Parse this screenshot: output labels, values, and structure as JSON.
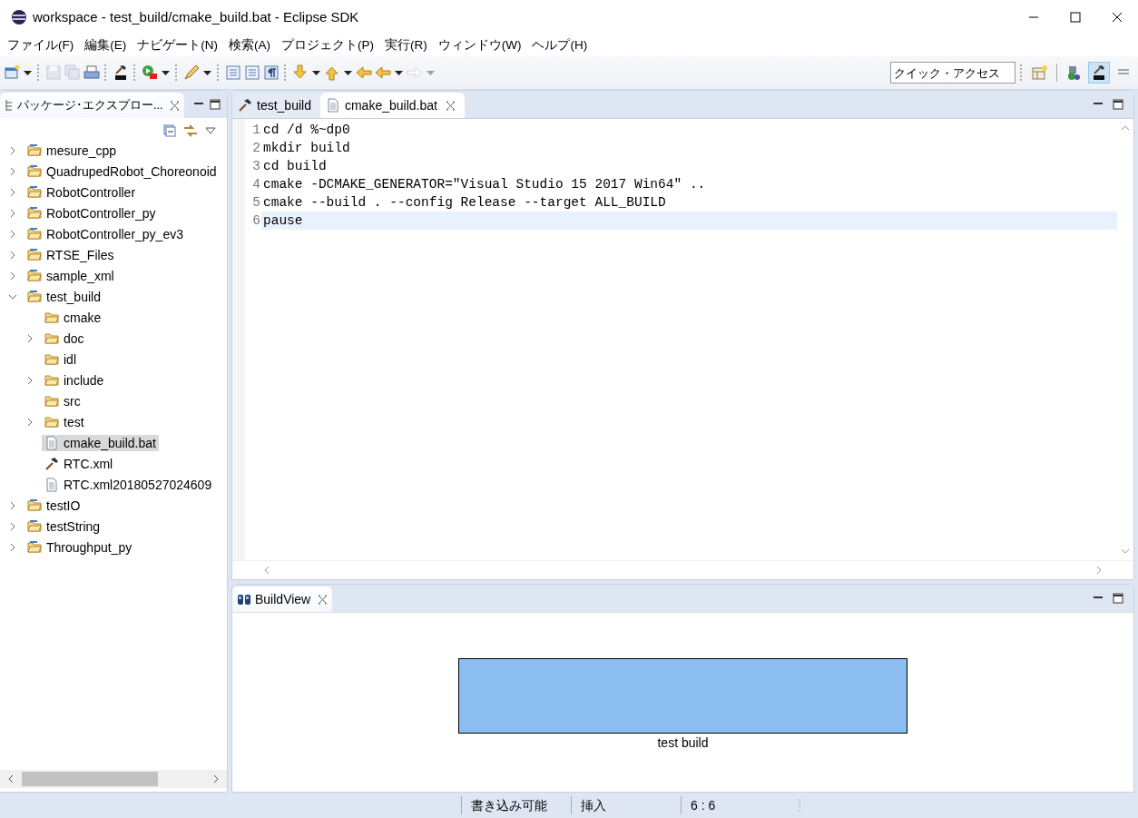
{
  "window": {
    "title": "workspace - test_build/cmake_build.bat - Eclipse SDK"
  },
  "menu": [
    "ファイル(F)",
    "編集(E)",
    "ナビゲート(N)",
    "検索(A)",
    "プロジェクト(P)",
    "実行(R)",
    "ウィンドウ(W)",
    "ヘルプ(H)"
  ],
  "toolbar": [
    {
      "kind": "new",
      "disabled": false
    },
    {
      "kind": "dropdown",
      "disabled": false
    },
    {
      "kind": "sep"
    },
    {
      "kind": "save",
      "disabled": true
    },
    {
      "kind": "save-all",
      "disabled": true
    },
    {
      "kind": "print",
      "disabled": false
    },
    {
      "kind": "sep"
    },
    {
      "kind": "rt",
      "disabled": false
    },
    {
      "kind": "sep"
    },
    {
      "kind": "run",
      "disabled": false
    },
    {
      "kind": "dropdown",
      "disabled": false
    },
    {
      "kind": "sep"
    },
    {
      "kind": "pen",
      "disabled": false
    },
    {
      "kind": "dropdown",
      "disabled": false
    },
    {
      "kind": "sep"
    },
    {
      "kind": "doc",
      "disabled": false
    },
    {
      "kind": "doc",
      "disabled": false
    },
    {
      "kind": "para",
      "disabled": false
    },
    {
      "kind": "sep"
    },
    {
      "kind": "down",
      "disabled": false
    },
    {
      "kind": "dropdown",
      "disabled": false
    },
    {
      "kind": "up",
      "disabled": false
    },
    {
      "kind": "dropdown",
      "disabled": false
    },
    {
      "kind": "back",
      "disabled": false
    },
    {
      "kind": "back",
      "disabled": false
    },
    {
      "kind": "dropdown",
      "disabled": false
    },
    {
      "kind": "forward",
      "disabled": true
    },
    {
      "kind": "dropdown",
      "disabled": true
    }
  ],
  "quick_access": {
    "placeholder": "クイック・アクセス"
  },
  "perspectives": [
    {
      "kind": "open",
      "selected": false
    },
    {
      "kind": "java",
      "selected": false
    },
    {
      "kind": "rt",
      "selected": true
    },
    {
      "kind": "rt-plain",
      "selected": false
    }
  ],
  "explorer": {
    "title": "パッケージ･エクスプロー...",
    "items": [
      {
        "label": "mesure_cpp",
        "kind": "project",
        "expanded": false,
        "selected": false
      },
      {
        "label": "QuadrupedRobot_Choreonoid",
        "kind": "project",
        "expanded": false,
        "selected": false
      },
      {
        "label": "RobotController",
        "kind": "project",
        "expanded": false,
        "selected": false
      },
      {
        "label": "RobotController_py",
        "kind": "project",
        "expanded": false,
        "selected": false
      },
      {
        "label": "RobotController_py_ev3",
        "kind": "project",
        "expanded": false,
        "selected": false
      },
      {
        "label": "RTSE_Files",
        "kind": "project",
        "expanded": false,
        "selected": false
      },
      {
        "label": "sample_xml",
        "kind": "project",
        "expanded": false,
        "selected": false
      },
      {
        "label": "test_build",
        "kind": "project",
        "expanded": true,
        "selected": false,
        "children": [
          {
            "label": "cmake",
            "kind": "folder",
            "selected": false
          },
          {
            "label": "doc",
            "kind": "folder",
            "expanded": false,
            "selected": false
          },
          {
            "label": "idl",
            "kind": "folder",
            "selected": false
          },
          {
            "label": "include",
            "kind": "folder",
            "expanded": false,
            "selected": false
          },
          {
            "label": "src",
            "kind": "folder",
            "selected": false
          },
          {
            "label": "test",
            "kind": "folder",
            "expanded": false,
            "selected": false
          },
          {
            "label": "cmake_build.bat",
            "kind": "file",
            "selected": true
          },
          {
            "label": "RTC.xml",
            "kind": "rtc",
            "selected": false
          },
          {
            "label": "RTC.xml20180527024609",
            "kind": "file",
            "selected": false
          }
        ]
      },
      {
        "label": "testIO",
        "kind": "project",
        "expanded": false,
        "selected": false
      },
      {
        "label": "testString",
        "kind": "project",
        "expanded": false,
        "selected": false
      },
      {
        "label": "Throughput_py",
        "kind": "project",
        "expanded": false,
        "selected": false
      }
    ]
  },
  "editor": {
    "tabs": [
      {
        "label": "test_build",
        "kind": "rtc",
        "selected": false
      },
      {
        "label": "cmake_build.bat",
        "kind": "file",
        "selected": true
      }
    ],
    "lines": [
      {
        "number": "1",
        "text": "cd /d %~dp0",
        "current": false
      },
      {
        "number": "2",
        "text": "mkdir build",
        "current": false
      },
      {
        "number": "3",
        "text": "cd build",
        "current": false
      },
      {
        "number": "4",
        "text": "cmake -DCMAKE_GENERATOR=\"Visual Studio 15 2017 Win64\" ..",
        "current": false
      },
      {
        "number": "5",
        "text": "cmake --build . --config Release --target ALL_BUILD",
        "current": false
      },
      {
        "number": "6",
        "text": "pause",
        "current": true
      }
    ]
  },
  "build_view": {
    "title": "BuildView",
    "blocks": [
      {
        "label": "test build"
      }
    ]
  },
  "status_bar": [
    "書き込み可能",
    "挿入",
    "6 : 6"
  ]
}
